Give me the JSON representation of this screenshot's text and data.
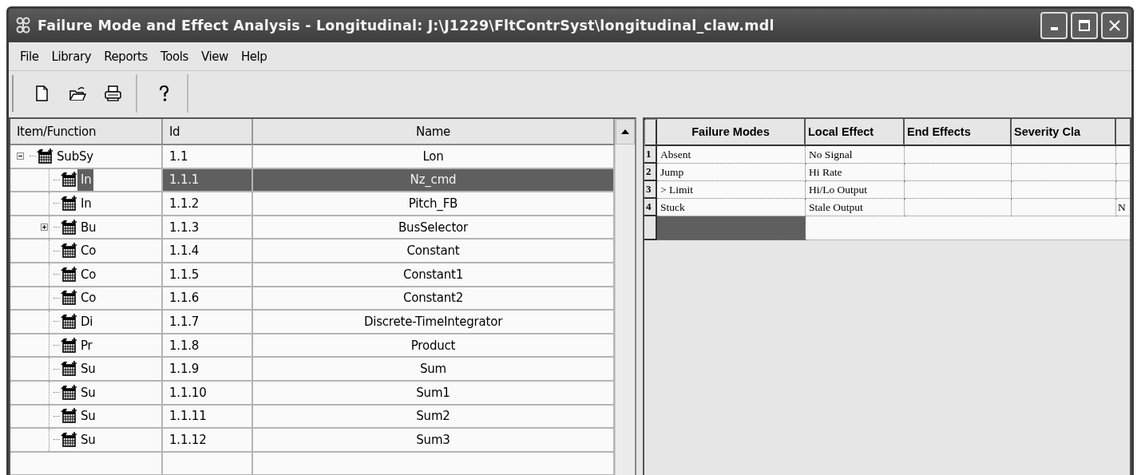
{
  "window": {
    "title": "Failure Mode and Effect Analysis - Longitudinal: J:\\J1229\\FltContrSyst\\longitudinal_claw.mdl"
  },
  "menu": [
    "File",
    "Library",
    "Reports",
    "Tools",
    "View",
    "Help"
  ],
  "toolbar": [
    {
      "kind": "new"
    },
    {
      "kind": "open"
    },
    {
      "kind": "print"
    },
    {
      "kind": "separator"
    },
    {
      "kind": "help"
    }
  ],
  "tree_table": {
    "columns": [
      "Item/Function",
      "Id",
      "Name"
    ],
    "rows": [
      {
        "label": "SubSy",
        "id": "1.1",
        "name": "Lon",
        "expanded": true,
        "selected": false,
        "children": [
          {
            "label": "In",
            "id": "1.1.1",
            "name": "Nz_cmd",
            "selected": true
          },
          {
            "label": "In",
            "id": "1.1.2",
            "name": "Pitch_FB",
            "selected": false
          },
          {
            "label": "Bu",
            "id": "1.1.3",
            "name": "BusSelector",
            "selected": false,
            "expanded": false
          },
          {
            "label": "Co",
            "id": "1.1.4",
            "name": "Constant",
            "selected": false
          },
          {
            "label": "Co",
            "id": "1.1.5",
            "name": "Constant1",
            "selected": false
          },
          {
            "label": "Co",
            "id": "1.1.6",
            "name": "Constant2",
            "selected": false
          },
          {
            "label": "Di",
            "id": "1.1.7",
            "name": "Discrete-TimeIntegrator",
            "selected": false
          },
          {
            "label": "Pr",
            "id": "1.1.8",
            "name": "Product",
            "selected": false
          },
          {
            "label": "Su",
            "id": "1.1.9",
            "name": "Sum",
            "selected": false
          },
          {
            "label": "Su",
            "id": "1.1.10",
            "name": "Sum1",
            "selected": false
          },
          {
            "label": "Su",
            "id": "1.1.11",
            "name": "Sum2",
            "selected": false
          },
          {
            "label": "Su",
            "id": "1.1.12",
            "name": "Sum3",
            "selected": false
          }
        ]
      }
    ]
  },
  "grid": {
    "columns": [
      "Failure Modes",
      "Local Effect",
      "End Effects",
      "Severity Cla"
    ],
    "rows": [
      {
        "number": "1",
        "failure_mode": "Absent",
        "local_effect": "No Signal"
      },
      {
        "number": "2",
        "failure_mode": "Jump",
        "local_effect": "Hi Rate"
      },
      {
        "number": "3",
        "failure_mode": "> Limit",
        "local_effect": "Hi/Lo Output"
      },
      {
        "number": "4",
        "failure_mode": "Stuck",
        "local_effect": "Stale Output",
        "column_5": "N"
      }
    ],
    "new_row": {
      "selected": true
    }
  }
}
